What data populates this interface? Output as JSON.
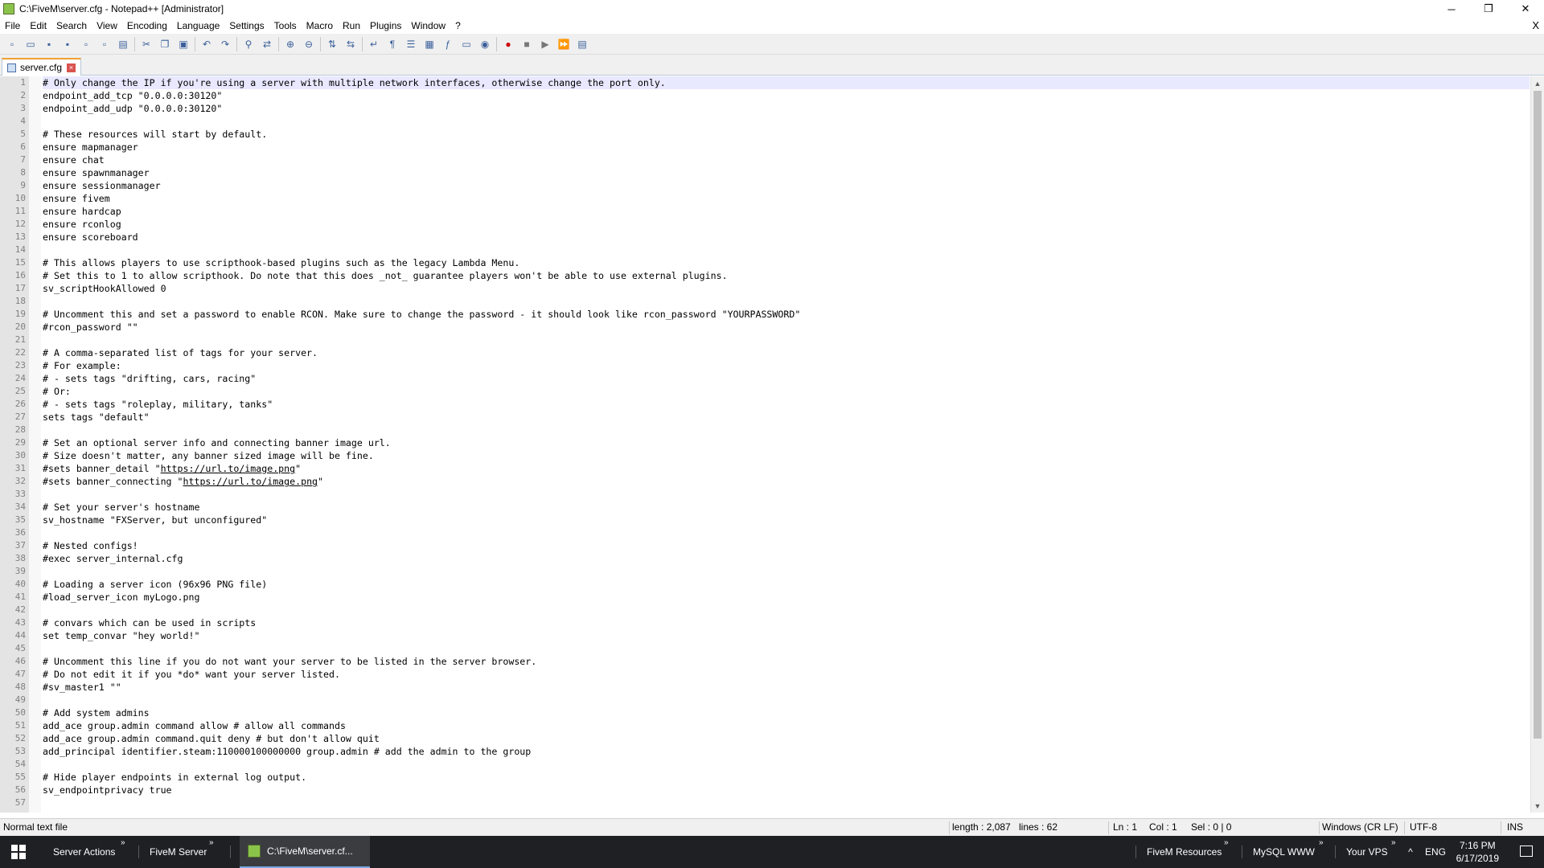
{
  "window": {
    "title": "C:\\FiveM\\server.cfg - Notepad++ [Administrator]",
    "controls": {
      "minimize": "─",
      "maximize": "❐",
      "close": "✕"
    }
  },
  "menu": {
    "items": [
      "File",
      "Edit",
      "Search",
      "View",
      "Encoding",
      "Language",
      "Settings",
      "Tools",
      "Macro",
      "Run",
      "Plugins",
      "Window",
      "?"
    ],
    "doc_close": "X"
  },
  "toolbar": {
    "icons": [
      "new-file-icon",
      "open-file-icon",
      "save-icon",
      "save-all-icon",
      "close-icon",
      "close-all-icon",
      "print-icon",
      "cut-icon",
      "copy-icon",
      "paste-icon",
      "undo-icon",
      "redo-icon",
      "find-icon",
      "replace-icon",
      "zoom-in-icon",
      "zoom-out-icon",
      "sync-vertical-icon",
      "sync-horizontal-icon",
      "word-wrap-icon",
      "show-all-chars-icon",
      "indent-guide-icon",
      "doc-map-icon",
      "function-list-icon",
      "folder-workspace-icon",
      "monitoring-icon",
      "record-macro-icon",
      "stop-record-icon",
      "play-macro-icon",
      "run-macro-multiple-icon",
      "save-macro-icon"
    ]
  },
  "tab": {
    "label": "server.cfg"
  },
  "editor": {
    "line_numbers": [
      "1",
      "2",
      "3",
      "4",
      "5",
      "6",
      "7",
      "8",
      "9",
      "10",
      "11",
      "12",
      "13",
      "14",
      "15",
      "16",
      "17",
      "18",
      "19",
      "20",
      "21",
      "22",
      "23",
      "24",
      "25",
      "26",
      "27",
      "28",
      "29",
      "30",
      "31",
      "32",
      "33",
      "34",
      "35",
      "36",
      "37",
      "38",
      "39",
      "40",
      "41",
      "42",
      "43",
      "44",
      "45",
      "46",
      "47",
      "48",
      "49",
      "50",
      "51",
      "52",
      "53",
      "54",
      "55",
      "56",
      "57"
    ],
    "lines": [
      "# Only change the IP if you're using a server with multiple network interfaces, otherwise change the port only.",
      "endpoint_add_tcp \"0.0.0.0:30120\"",
      "endpoint_add_udp \"0.0.0.0:30120\"",
      "",
      "# These resources will start by default.",
      "ensure mapmanager",
      "ensure chat",
      "ensure spawnmanager",
      "ensure sessionmanager",
      "ensure fivem",
      "ensure hardcap",
      "ensure rconlog",
      "ensure scoreboard",
      "",
      "# This allows players to use scripthook-based plugins such as the legacy Lambda Menu.",
      "# Set this to 1 to allow scripthook. Do note that this does _not_ guarantee players won't be able to use external plugins.",
      "sv_scriptHookAllowed 0",
      "",
      "# Uncomment this and set a password to enable RCON. Make sure to change the password - it should look like rcon_password \"YOURPASSWORD\"",
      "#rcon_password \"\"",
      "",
      "# A comma-separated list of tags for your server.",
      "# For example:",
      "# - sets tags \"drifting, cars, racing\"",
      "# Or:",
      "# - sets tags \"roleplay, military, tanks\"",
      "sets tags \"default\"",
      "",
      "# Set an optional server info and connecting banner image url.",
      "# Size doesn't matter, any banner sized image will be fine.",
      "#sets banner_detail \"https://url.to/image.png\"",
      "#sets banner_connecting \"https://url.to/image.png\"",
      "",
      "# Set your server's hostname",
      "sv_hostname \"FXServer, but unconfigured\"",
      "",
      "# Nested configs!",
      "#exec server_internal.cfg",
      "",
      "# Loading a server icon (96x96 PNG file)",
      "#load_server_icon myLogo.png",
      "",
      "# convars which can be used in scripts",
      "set temp_convar \"hey world!\"",
      "",
      "# Uncomment this line if you do not want your server to be listed in the server browser.",
      "# Do not edit it if you *do* want your server listed.",
      "#sv_master1 \"\"",
      "",
      "# Add system admins",
      "add_ace group.admin command allow # allow all commands",
      "add_ace group.admin command.quit deny # but don't allow quit",
      "add_principal identifier.steam:110000100000000 group.admin # add the admin to the group",
      "",
      "# Hide player endpoints in external log output.",
      "sv_endpointprivacy true",
      ""
    ]
  },
  "status": {
    "file_type": "Normal text file",
    "length": "length : 2,087",
    "lines": "lines : 62",
    "ln": "Ln : 1",
    "col": "Col : 1",
    "sel": "Sel : 0 | 0",
    "eol": "Windows (CR LF)",
    "encoding": "UTF-8",
    "mode": "INS"
  },
  "taskbar": {
    "items": [
      "Server Actions",
      "FiveM Server",
      "C:\\FiveM\\server.cf...",
      "FiveM Resources",
      "MySQL WWW",
      "Your VPS"
    ],
    "chevron": "»",
    "tray_up": "^",
    "language": "ENG",
    "time": "7:16 PM",
    "date": "6/17/2019"
  }
}
